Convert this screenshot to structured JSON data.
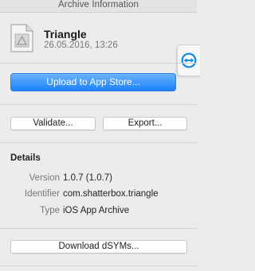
{
  "window": {
    "title": "Archive Information"
  },
  "archive": {
    "name": "Triangle",
    "date": "26.05.2016, 13:26"
  },
  "actions": {
    "upload_label": "Upload to App Store...",
    "validate_label": "Validate...",
    "export_label": "Export...",
    "download_dsyms_label": "Download dSYMs..."
  },
  "details": {
    "title": "Details",
    "rows": [
      {
        "key": "Version",
        "value": "1.0.7 (1.0.7)"
      },
      {
        "key": "Identifier",
        "value": "com.shatterbox.triangle"
      },
      {
        "key": "Type",
        "value": "iOS App Archive"
      }
    ]
  },
  "icons": {
    "app": "app-icon-placeholder",
    "teamviewer": "teamviewer-icon"
  },
  "colors": {
    "accent_blue": "#1a82fb",
    "teamviewer_blue": "#0e8ee9"
  }
}
